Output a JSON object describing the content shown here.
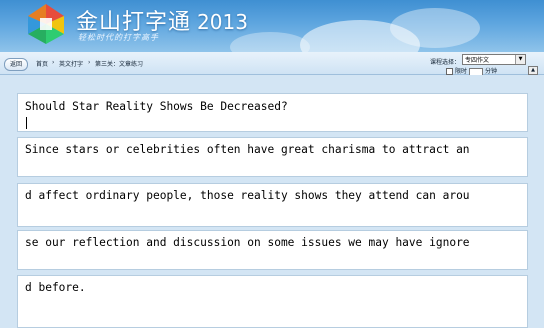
{
  "app": {
    "brand": "金山打字通",
    "year": "2013",
    "slogan": "轻松时代的打字高手"
  },
  "nav": {
    "back_label": "返回",
    "breadcrumb": [
      "首页",
      "英文打字",
      "第三关：文章练习"
    ],
    "course_label": "课程选择：",
    "course_value": "专四作文",
    "timer_label": "限时",
    "timer_unit": "分钟"
  },
  "practice": {
    "title_line": "Should Star Reality Shows Be Decreased?",
    "lines": [
      "Since stars or celebrities often have great charisma to attract an",
      "d affect ordinary people, those reality shows they attend can arou",
      "se our reflection and discussion on some issues we may have ignore",
      "d before."
    ]
  }
}
